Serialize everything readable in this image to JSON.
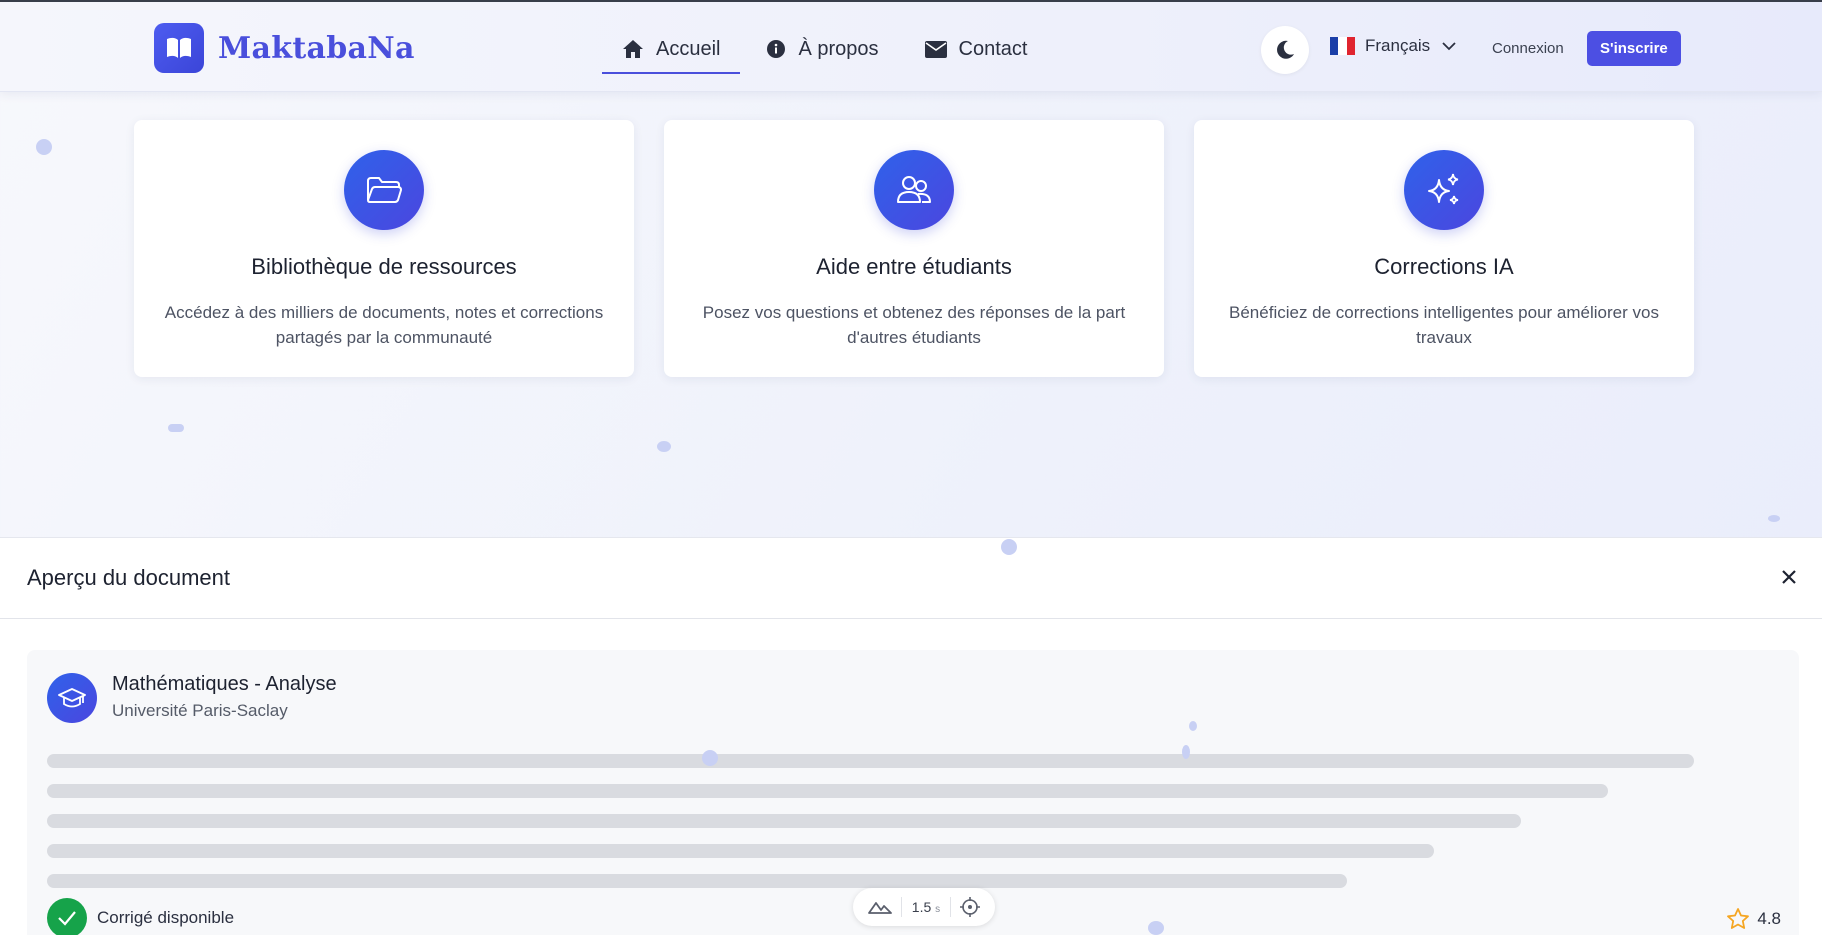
{
  "brand": {
    "name": "MaktabaNa"
  },
  "nav": {
    "items": [
      {
        "label": "Accueil",
        "icon": "home-icon",
        "active": true
      },
      {
        "label": "À propos",
        "icon": "info-icon",
        "active": false
      },
      {
        "label": "Contact",
        "icon": "envelope-icon",
        "active": false
      }
    ]
  },
  "header": {
    "language": "Français",
    "login_label": "Connexion",
    "signup_label": "S'inscrire"
  },
  "features": [
    {
      "title": "Bibliothèque de ressources",
      "description": "Accédez à des milliers de documents, notes et corrections partagés par la communauté",
      "icon": "folder-icon"
    },
    {
      "title": "Aide entre étudiants",
      "description": "Posez vos questions et obtenez des réponses de la part d'autres étudiants",
      "icon": "users-icon"
    },
    {
      "title": "Corrections IA",
      "description": "Bénéficiez de corrections intelligentes pour améliorer vos travaux",
      "icon": "sparkles-icon"
    }
  ],
  "preview": {
    "title": "Aperçu du document",
    "document": {
      "subject": "Mathématiques - Analyse",
      "university": "Université Paris-Saclay",
      "status": "Corrigé disponible",
      "rating": "4.8"
    }
  },
  "toolbar": {
    "value": "1.5",
    "unit": "s"
  },
  "colors": {
    "accent": "#4c4fe3",
    "success": "#16a34a",
    "star": "#f5a623"
  }
}
